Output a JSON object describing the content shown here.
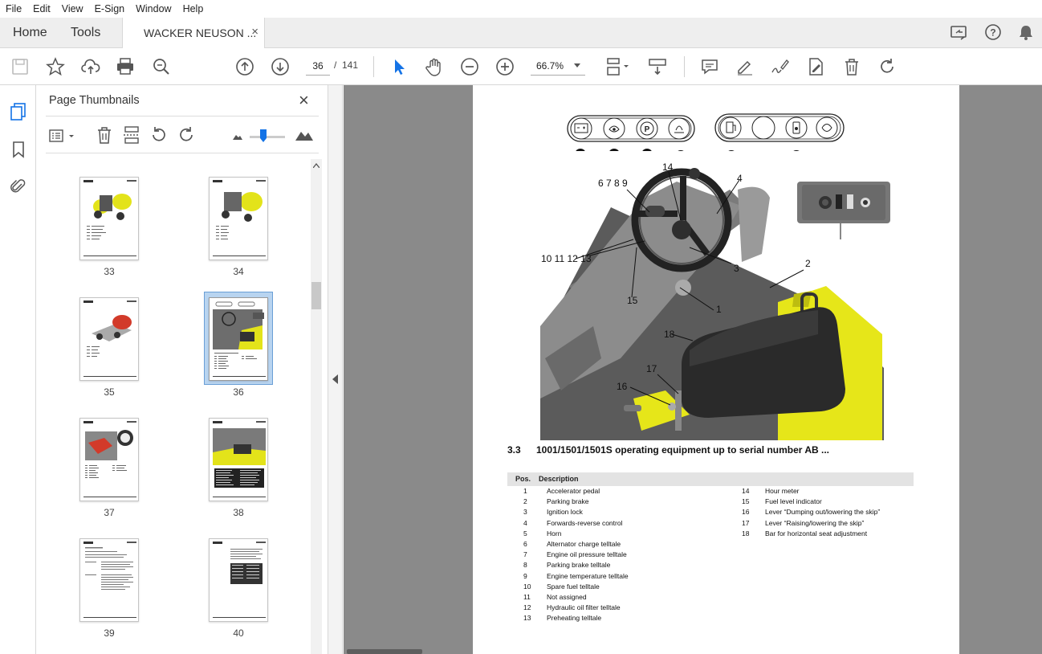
{
  "menu": [
    "File",
    "Edit",
    "View",
    "E-Sign",
    "Window",
    "Help"
  ],
  "tabs": {
    "home": "Home",
    "tools": "Tools",
    "doc_title": "WACKER NEUSON ...",
    "close": "×"
  },
  "toolbar": {
    "page_current": "36",
    "page_sep": "/",
    "page_total": "141",
    "zoom": "66.7%"
  },
  "panel": {
    "title": "Page Thumbnails",
    "close": "×",
    "thumbnails": [
      {
        "label": "33"
      },
      {
        "label": "34"
      },
      {
        "label": "35"
      },
      {
        "label": "36",
        "selected": true
      },
      {
        "label": "37"
      },
      {
        "label": "38"
      },
      {
        "label": "39"
      },
      {
        "label": "40"
      }
    ]
  },
  "doc": {
    "indicator_numbers": [
      "6",
      "7",
      "8",
      "9",
      "10",
      "11",
      "12",
      "13"
    ],
    "callouts": [
      "14",
      "4",
      "6 7 8 9",
      "10 11 12 13",
      "3",
      "2",
      "15",
      "1",
      "18",
      "17",
      "16",
      "3"
    ],
    "section_number": "3.3",
    "section_title": "1001/1501/1501S operating equipment up to serial number AB ...",
    "table_headers": {
      "pos": "Pos.",
      "desc": "Description"
    },
    "left_rows": [
      {
        "pos": "1",
        "desc": "Accelerator pedal"
      },
      {
        "pos": "2",
        "desc": "Parking brake"
      },
      {
        "pos": "3",
        "desc": "Ignition lock"
      },
      {
        "pos": "4",
        "desc": "Forwards-reverse control"
      },
      {
        "pos": "5",
        "desc": "Horn"
      },
      {
        "pos": "6",
        "desc": "Alternator charge telltale"
      },
      {
        "pos": "7",
        "desc": "Engine oil pressure telltale"
      },
      {
        "pos": "8",
        "desc": "Parking brake telltale"
      },
      {
        "pos": "9",
        "desc": "Engine temperature telltale"
      },
      {
        "pos": "10",
        "desc": "Spare fuel telltale"
      },
      {
        "pos": "11",
        "desc": "Not assigned"
      },
      {
        "pos": "12",
        "desc": "Hydraulic oil filter telltale"
      },
      {
        "pos": "13",
        "desc": "Preheating telltale"
      }
    ],
    "right_rows": [
      {
        "pos": "14",
        "desc": "Hour meter"
      },
      {
        "pos": "15",
        "desc": "Fuel level indicator"
      },
      {
        "pos": "16",
        "desc": "Lever “Dumping out/lowering the skip”"
      },
      {
        "pos": "17",
        "desc": "Lever “Raising/lowering the skip”"
      },
      {
        "pos": "18",
        "desc": "Bar for horizontal seat adjustment"
      }
    ]
  },
  "colors": {
    "accent": "#1473e6",
    "machine_yellow": "#e6e619",
    "doc_bg": "#8a8a8a"
  }
}
